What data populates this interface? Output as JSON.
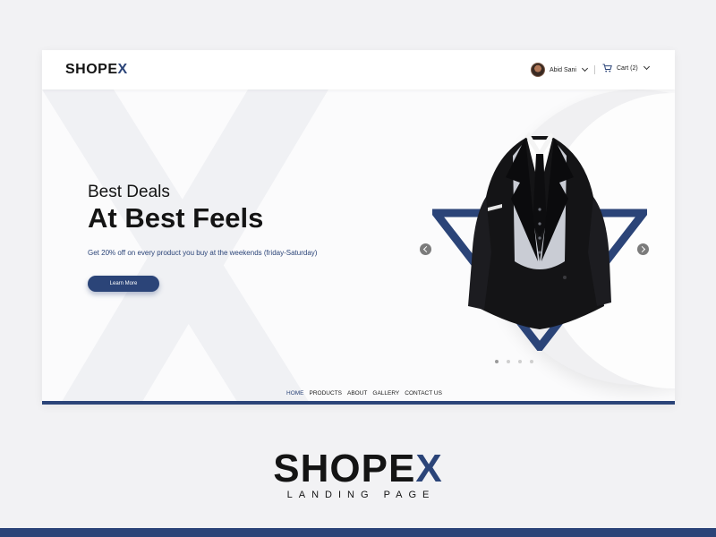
{
  "header": {
    "logo_main": "SHOPE",
    "logo_accent": "X",
    "user_name": "Abid Sani",
    "cart_label": "Cart (2)"
  },
  "hero": {
    "subtitle": "Best Deals",
    "title": "At Best Feels",
    "description": "Get 20% off on every product you buy at the weekends (friday-Saturday)",
    "cta_label": "Learn More"
  },
  "carousel": {
    "slides": 4,
    "active_index": 0
  },
  "bottom_nav": {
    "items": [
      "HOME",
      "PRODUCTS",
      "ABOUT",
      "GALLERY",
      "CONTACT US"
    ],
    "active": "HOME"
  },
  "brand": {
    "name_main": "SHOPE",
    "name_accent": "X",
    "tagline": "LANDING PAGE"
  },
  "icons": {
    "cart": "cart-icon",
    "user_dropdown": "chevron-down-icon",
    "prev": "chevron-left-icon",
    "next": "chevron-right-icon"
  },
  "colors": {
    "accent": "#2b4478",
    "text": "#141414",
    "background": "#f2f2f4"
  }
}
